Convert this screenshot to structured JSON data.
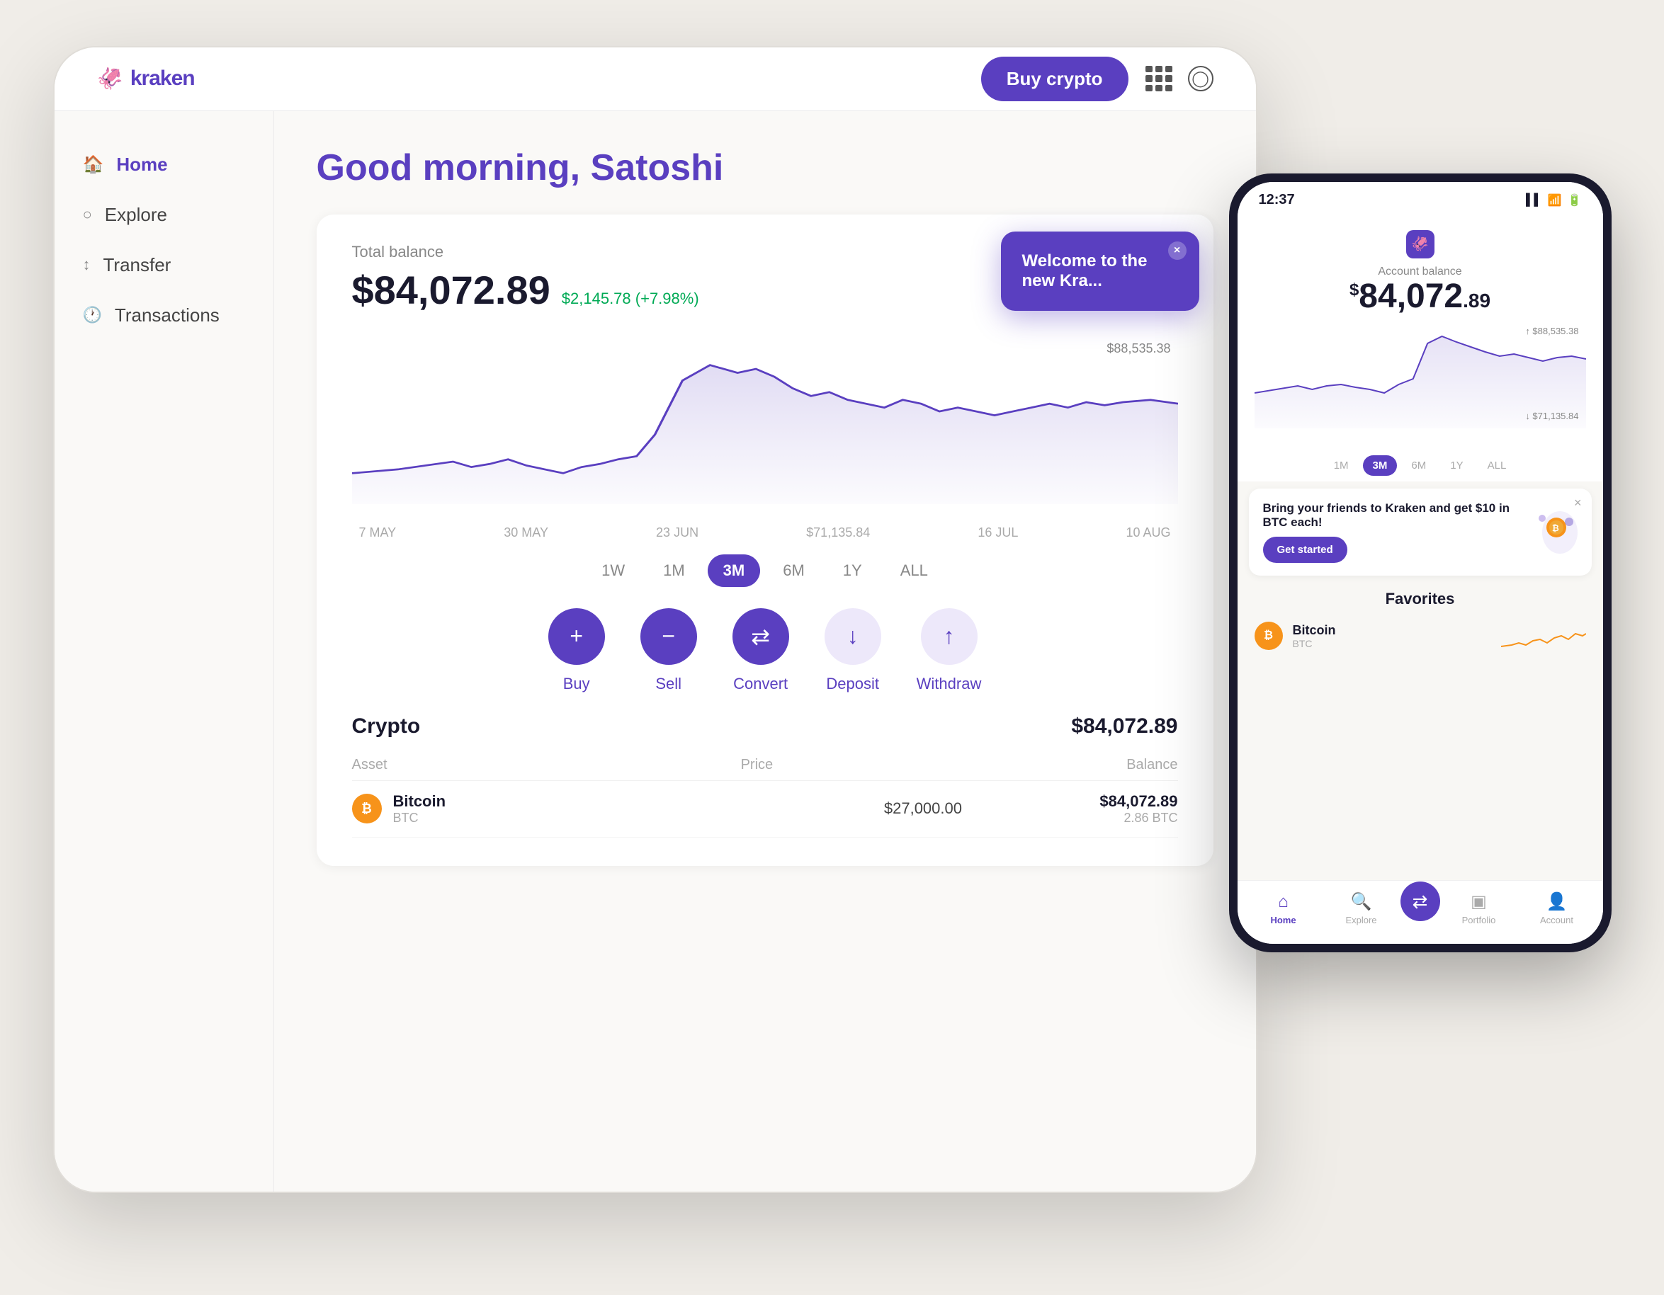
{
  "tablet": {
    "logo": "🐙kraken",
    "topbar": {
      "buy_crypto_label": "Buy crypto",
      "grid_icon": "grid-icon",
      "user_icon": "user-icon"
    },
    "sidebar": {
      "items": [
        {
          "label": "Home",
          "icon": "🏠",
          "active": true
        },
        {
          "label": "Explore",
          "icon": "🔍",
          "active": false
        },
        {
          "label": "Transfer",
          "icon": "↕",
          "active": false
        },
        {
          "label": "Transactions",
          "icon": "🕐",
          "active": false
        }
      ]
    },
    "main": {
      "greeting": "Good morning, Satoshi",
      "balance_card": {
        "label": "Total balance",
        "amount": "$84,072.89",
        "change": "$2,145.78 (+7.98%)",
        "chart_high": "$88,535.38",
        "x_labels": [
          "7 MAY",
          "30 MAY",
          "23 JUN",
          "$71,135.84",
          "16 JUL",
          "10 AUG"
        ],
        "periods": [
          "1W",
          "1M",
          "3M",
          "6M",
          "1Y",
          "ALL"
        ],
        "active_period": "3M"
      },
      "actions": [
        {
          "label": "Buy",
          "icon": "+",
          "style": "filled"
        },
        {
          "label": "Sell",
          "icon": "−",
          "style": "filled"
        },
        {
          "label": "Convert",
          "icon": "⇄",
          "style": "filled"
        },
        {
          "label": "Deposit",
          "icon": "↓",
          "style": "light"
        },
        {
          "label": "Withdraw",
          "icon": "↑",
          "style": "light"
        }
      ],
      "crypto_section": {
        "title": "Crypto",
        "total": "$84,072.89",
        "columns": [
          "Asset",
          "Price",
          "Balance"
        ],
        "rows": [
          {
            "name": "Bitcoin",
            "ticker": "BTC",
            "price": "$27,000.00",
            "balance_usd": "$84,072.89",
            "balance_crypto": "2.86 BTC"
          }
        ]
      }
    },
    "welcome_banner": {
      "text": "Welcome to the new Kra...",
      "close": "×"
    }
  },
  "phone": {
    "statusbar": {
      "time": "12:37",
      "icons": "▌▌ ⬤ ▪"
    },
    "balance": {
      "label": "Account balance",
      "dollar": "$",
      "main": "84,072",
      "decimal": ".89"
    },
    "chart": {
      "high_label": "↑ $88,535.38",
      "low_label": "↓ $71,135.84",
      "periods": [
        "1M",
        "3M",
        "6M",
        "1Y",
        "ALL"
      ],
      "active_period": "3M"
    },
    "referral": {
      "title": "Bring your friends to Kraken and get $10 in BTC each!",
      "cta": "Get started",
      "close": "×"
    },
    "favorites": {
      "title": "Favorites",
      "items": [
        {
          "name": "Bitcoin",
          "ticker": "BTC",
          "icon_bg": "#f7931a"
        }
      ]
    },
    "bottom_nav": [
      {
        "label": "Home",
        "icon": "⌂",
        "active": true
      },
      {
        "label": "Explore",
        "icon": "⊕",
        "active": false
      },
      {
        "label": "",
        "icon": "⇄",
        "active": false,
        "center": true
      },
      {
        "label": "Portfolio",
        "icon": "▣",
        "active": false
      },
      {
        "label": "Account",
        "icon": "👤",
        "active": false
      }
    ]
  }
}
